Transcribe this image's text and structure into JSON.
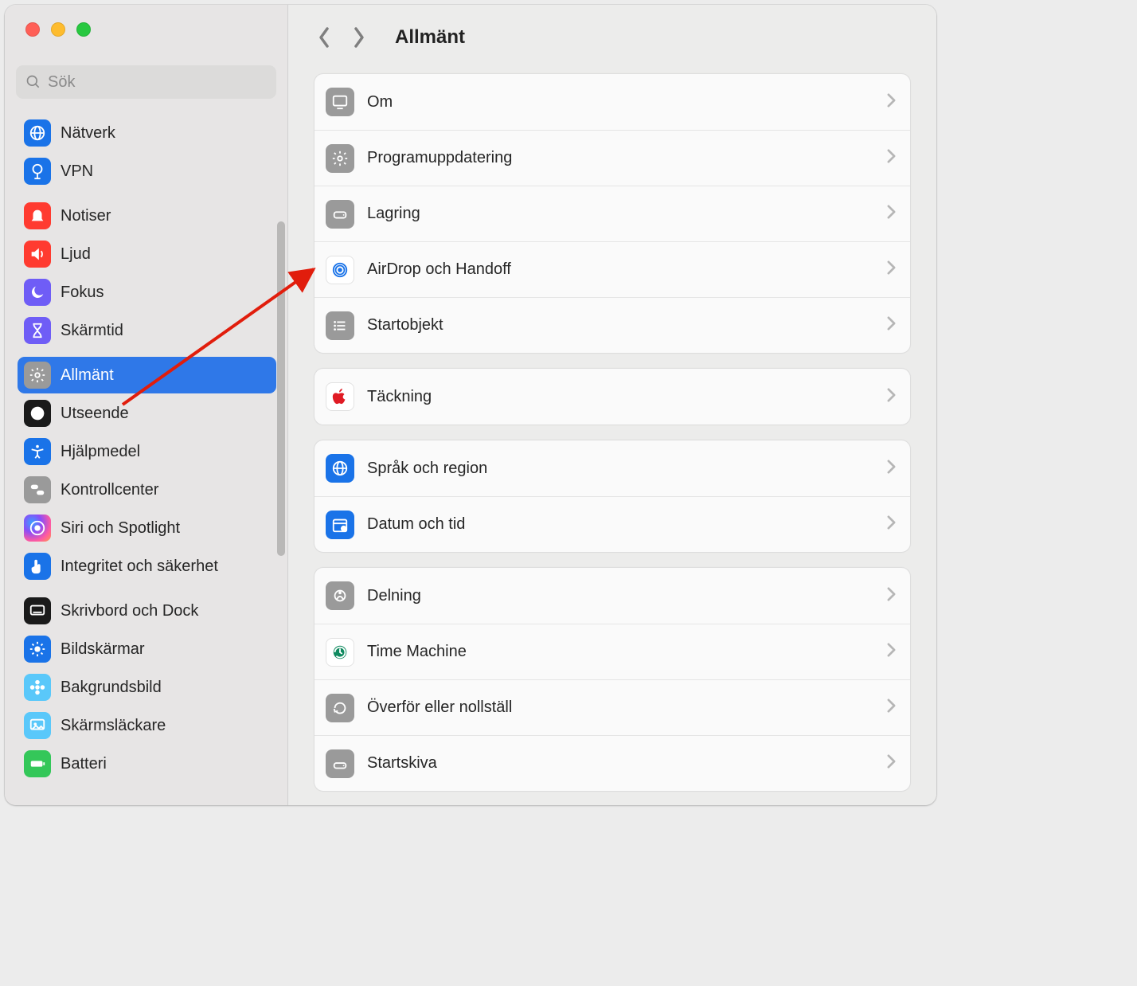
{
  "window": {
    "search_placeholder": "Sök"
  },
  "sidebar": {
    "items": [
      {
        "id": "natverk",
        "label": "Nätverk",
        "icon": "globe-icon",
        "color": "bg-blue"
      },
      {
        "id": "vpn",
        "label": "VPN",
        "icon": "vpn-icon",
        "color": "bg-blue"
      },
      {
        "id": "notiser",
        "label": "Notiser",
        "icon": "bell-icon",
        "color": "bg-red2"
      },
      {
        "id": "ljud",
        "label": "Ljud",
        "icon": "speaker-icon",
        "color": "bg-red2"
      },
      {
        "id": "fokus",
        "label": "Fokus",
        "icon": "moon-icon",
        "color": "bg-purple"
      },
      {
        "id": "skarmtid",
        "label": "Skärmtid",
        "icon": "hourglass-icon",
        "color": "bg-purple"
      },
      {
        "id": "allmant",
        "label": "Allmänt",
        "icon": "gear-icon",
        "color": "bg-gray",
        "selected": true
      },
      {
        "id": "utseende",
        "label": "Utseende",
        "icon": "appearance-icon",
        "color": "bg-black"
      },
      {
        "id": "hjalpmedel",
        "label": "Hjälpmedel",
        "icon": "accessibility-icon",
        "color": "bg-blue"
      },
      {
        "id": "kontroll",
        "label": "Kontrollcenter",
        "icon": "switches-icon",
        "color": "bg-gray"
      },
      {
        "id": "siri",
        "label": "Siri och Spotlight",
        "icon": "siri-icon",
        "color": "bg-siri"
      },
      {
        "id": "integritet",
        "label": "Integritet och säkerhet",
        "icon": "hand-icon",
        "color": "bg-blue"
      },
      {
        "id": "skrivbord",
        "label": "Skrivbord och Dock",
        "icon": "dock-icon",
        "color": "bg-black"
      },
      {
        "id": "bildskarm",
        "label": "Bildskärmar",
        "icon": "sun-icon",
        "color": "bg-blue"
      },
      {
        "id": "bakgrund",
        "label": "Bakgrundsbild",
        "icon": "flower-icon",
        "color": "bg-cyan"
      },
      {
        "id": "skarmsl",
        "label": "Skärmsläckare",
        "icon": "screensaver-icon",
        "color": "bg-cyan"
      },
      {
        "id": "batteri",
        "label": "Batteri",
        "icon": "battery-icon",
        "color": "bg-green"
      }
    ],
    "groups": [
      [
        0,
        1
      ],
      [
        2,
        3,
        4,
        5
      ],
      [
        6,
        7,
        8,
        9,
        10,
        11
      ],
      [
        12,
        13,
        14,
        15,
        16
      ]
    ]
  },
  "header": {
    "title": "Allmänt"
  },
  "main": {
    "sections": [
      [
        {
          "id": "om",
          "label": "Om",
          "icon": "display-icon",
          "color": "bg-gray"
        },
        {
          "id": "programupp",
          "label": "Programuppdatering",
          "icon": "gear-icon",
          "color": "bg-gray"
        },
        {
          "id": "lagring",
          "label": "Lagring",
          "icon": "disk-icon",
          "color": "bg-gray"
        },
        {
          "id": "airdrop",
          "label": "AirDrop och Handoff",
          "icon": "airdrop-icon",
          "color": "bg-white"
        },
        {
          "id": "startobjekt",
          "label": "Startobjekt",
          "icon": "list-icon",
          "color": "bg-gray"
        }
      ],
      [
        {
          "id": "tackning",
          "label": "Täckning",
          "icon": "apple-icon",
          "color": "bg-white"
        }
      ],
      [
        {
          "id": "sprak",
          "label": "Språk och region",
          "icon": "globe-icon",
          "color": "bg-blue"
        },
        {
          "id": "datum",
          "label": "Datum och tid",
          "icon": "calendar-icon",
          "color": "bg-blue"
        }
      ],
      [
        {
          "id": "delning",
          "label": "Delning",
          "icon": "share-icon",
          "color": "bg-gray"
        },
        {
          "id": "timemachine",
          "label": "Time Machine",
          "icon": "timemachine-icon",
          "color": "bg-white"
        },
        {
          "id": "overfor",
          "label": "Överför eller nollställ",
          "icon": "reset-icon",
          "color": "bg-gray"
        },
        {
          "id": "startskiva",
          "label": "Startskiva",
          "icon": "startdisk-icon",
          "color": "bg-gray"
        }
      ]
    ]
  },
  "annotation": {
    "arrow_color": "#e11d0c",
    "arrow_from_sidebar_item": "allmant",
    "arrow_to_main_row": "airdrop"
  }
}
